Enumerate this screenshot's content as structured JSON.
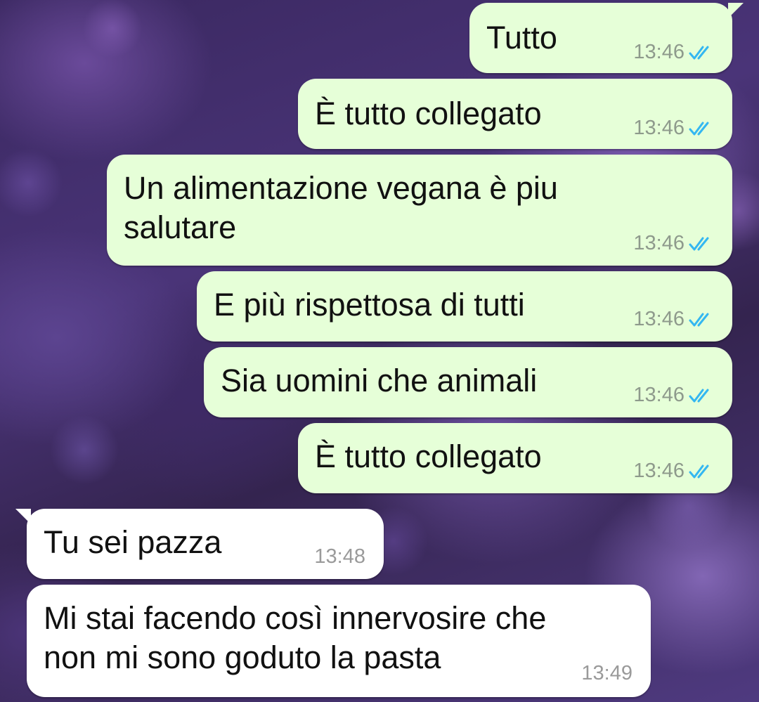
{
  "colors": {
    "outgoing_bubble": "#e6ffd8",
    "incoming_bubble": "#ffffff",
    "read_ticks": "#34b7f1"
  },
  "messages": [
    {
      "direction": "outgoing",
      "text": "Tutto",
      "time": "13:46",
      "status": "read-double-check-icon"
    },
    {
      "direction": "outgoing",
      "text": "È tutto collegato",
      "time": "13:46",
      "status": "read-double-check-icon"
    },
    {
      "direction": "outgoing",
      "text": "Un alimentazione vegana è piu\nsalutare",
      "time": "13:46",
      "status": "read-double-check-icon"
    },
    {
      "direction": "outgoing",
      "text": "E più rispettosa di tutti",
      "time": "13:46",
      "status": "read-double-check-icon"
    },
    {
      "direction": "outgoing",
      "text": "Sia uomini che animali",
      "time": "13:46",
      "status": "read-double-check-icon"
    },
    {
      "direction": "outgoing",
      "text": "È tutto collegato",
      "time": "13:46",
      "status": "read-double-check-icon"
    },
    {
      "direction": "incoming",
      "text": "Tu sei pazza",
      "time": "13:48"
    },
    {
      "direction": "incoming",
      "text": "Mi stai facendo così innervosire che\nnon mi sono goduto la pasta",
      "time": "13:49"
    }
  ]
}
